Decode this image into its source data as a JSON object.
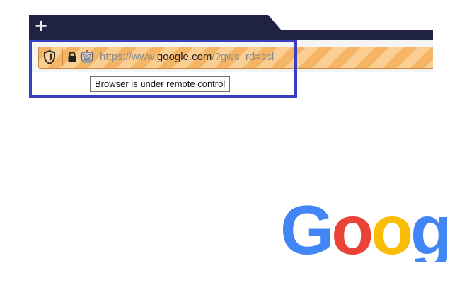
{
  "browser": {
    "new_tab_symbol": "+",
    "url": {
      "scheme": "https://www.",
      "host": "google.com",
      "rest": "/?gws_rd=ssl"
    },
    "tooltip": "Browser is under remote control",
    "icons": {
      "tracking": "shield-icon",
      "security": "lock-icon",
      "remote": "robot-icon"
    },
    "colors": {
      "tabstrip": "#1f2240",
      "remote_stripe_a": "#f5b567",
      "remote_stripe_b": "#fbcf94",
      "highlight_border": "#3a3fbf"
    }
  },
  "page": {
    "logo_letters": [
      {
        "char": "G",
        "color": "#4285F4"
      },
      {
        "char": "o",
        "color": "#EA4335"
      },
      {
        "char": "o",
        "color": "#FBBC05"
      },
      {
        "char": "g",
        "color": "#4285F4"
      }
    ]
  }
}
